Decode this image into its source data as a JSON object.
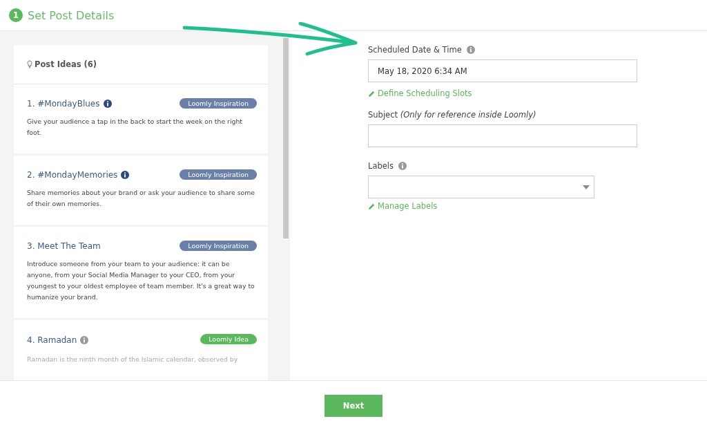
{
  "header": {
    "step": "1",
    "title": "Set Post Details"
  },
  "ideas": {
    "heading": "Post Ideas (6)",
    "items": [
      {
        "number": "1.",
        "title": "#MondayBlues",
        "info": true,
        "kind": "inspiration",
        "tag": "Loomly Inspiration",
        "text": "Give your audience a tap in the back to start the week on the right foot."
      },
      {
        "number": "2.",
        "title": "#MondayMemories",
        "info": true,
        "kind": "inspiration",
        "tag": "Loomly Inspiration",
        "text": "Share memories about your brand or ask your audience to share some of their own memories."
      },
      {
        "number": "3.",
        "title": "Meet The Team",
        "info": false,
        "kind": "inspiration",
        "tag": "Loomly Inspiration",
        "text": "Introduce someone from your team to your audience: it can be anyone, from your Social Media Manager to your CEO, from your youngest to your oldest employee of team member. It's a great way to humanize your brand."
      },
      {
        "number": "4.",
        "title": "Ramadan",
        "info": true,
        "kind": "idea",
        "tag": "Loomly Idea",
        "text": "Ramadan is the ninth month of the Islamic calendar, observed by"
      }
    ]
  },
  "form": {
    "date_label": "Scheduled Date & Time",
    "date_value": "May 18, 2020 6:34 AM",
    "slots_link": "Define Scheduling Slots",
    "subject_label": "Subject *(Only for reference inside Loomly)*",
    "labels_label": "Labels",
    "labels_link": "Manage Labels"
  },
  "footer": {
    "button": "Next"
  }
}
